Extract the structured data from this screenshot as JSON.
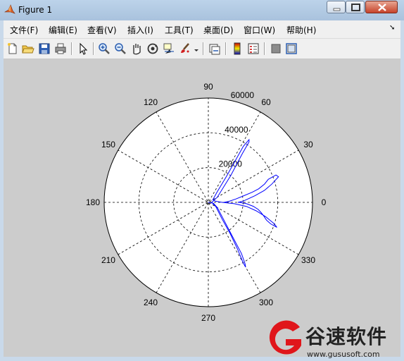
{
  "window": {
    "title": "Figure 1"
  },
  "menu": [
    "文件(F)",
    "编辑(E)",
    "查看(V)",
    "插入(I)",
    "工具(T)",
    "桌面(D)",
    "窗口(W)",
    "帮助(H)"
  ],
  "toolbar_icons": [
    "new-figure-icon",
    "open-file-icon",
    "save-icon",
    "print-icon",
    "pointer-icon",
    "zoom-in-icon",
    "zoom-out-icon",
    "pan-icon",
    "rotate-3d-icon",
    "data-cursor-icon",
    "brush-icon",
    "brush-dropdown-icon",
    "link-plot-icon",
    "colorbar-icon",
    "legend-icon",
    "hide-plot-tools-icon",
    "show-plot-tools-icon"
  ],
  "chart_data": {
    "type": "polar",
    "title": "",
    "angle_ticks_deg": [
      "0",
      "30",
      "60",
      "90",
      "120",
      "150",
      "180",
      "210",
      "240",
      "270",
      "300",
      "330"
    ],
    "radial_ticks": [
      "20000",
      "40000",
      "60000"
    ],
    "r_max": 60000,
    "grid": true,
    "line_color": "#0000ff",
    "series": [
      {
        "angle_deg": [
          0,
          3,
          7,
          10,
          13,
          15,
          18,
          21,
          22,
          20,
          16,
          12,
          8,
          5,
          2,
          0,
          0,
          -2,
          -5,
          -8,
          -11,
          -14,
          -17,
          -19,
          -20,
          -18,
          -14,
          -10,
          -6,
          -3,
          0,
          10,
          30,
          50,
          55,
          57,
          58,
          57,
          56,
          55,
          50,
          30,
          0,
          -30,
          -50,
          -55,
          -58,
          -60,
          -60,
          -59,
          -57,
          -55,
          -50,
          -30,
          -10,
          0
        ],
        "r": [
          9000,
          12000,
          16000,
          20000,
          26000,
          30000,
          34000,
          37000,
          42000,
          43000,
          38000,
          33000,
          27000,
          23000,
          20000,
          17000,
          18000,
          22000,
          26000,
          29000,
          31000,
          33000,
          35000,
          38000,
          42000,
          40000,
          34000,
          28000,
          22000,
          15000,
          8000,
          4000,
          3000,
          8000,
          18000,
          28000,
          38000,
          43000,
          42000,
          34000,
          20000,
          6000,
          2000,
          5000,
          12000,
          22000,
          32000,
          40000,
          43000,
          41000,
          35000,
          25000,
          15000,
          6000,
          3000,
          0
        ]
      }
    ]
  },
  "watermark": {
    "brand": "谷速软件",
    "url": "www.gususoft.com"
  }
}
